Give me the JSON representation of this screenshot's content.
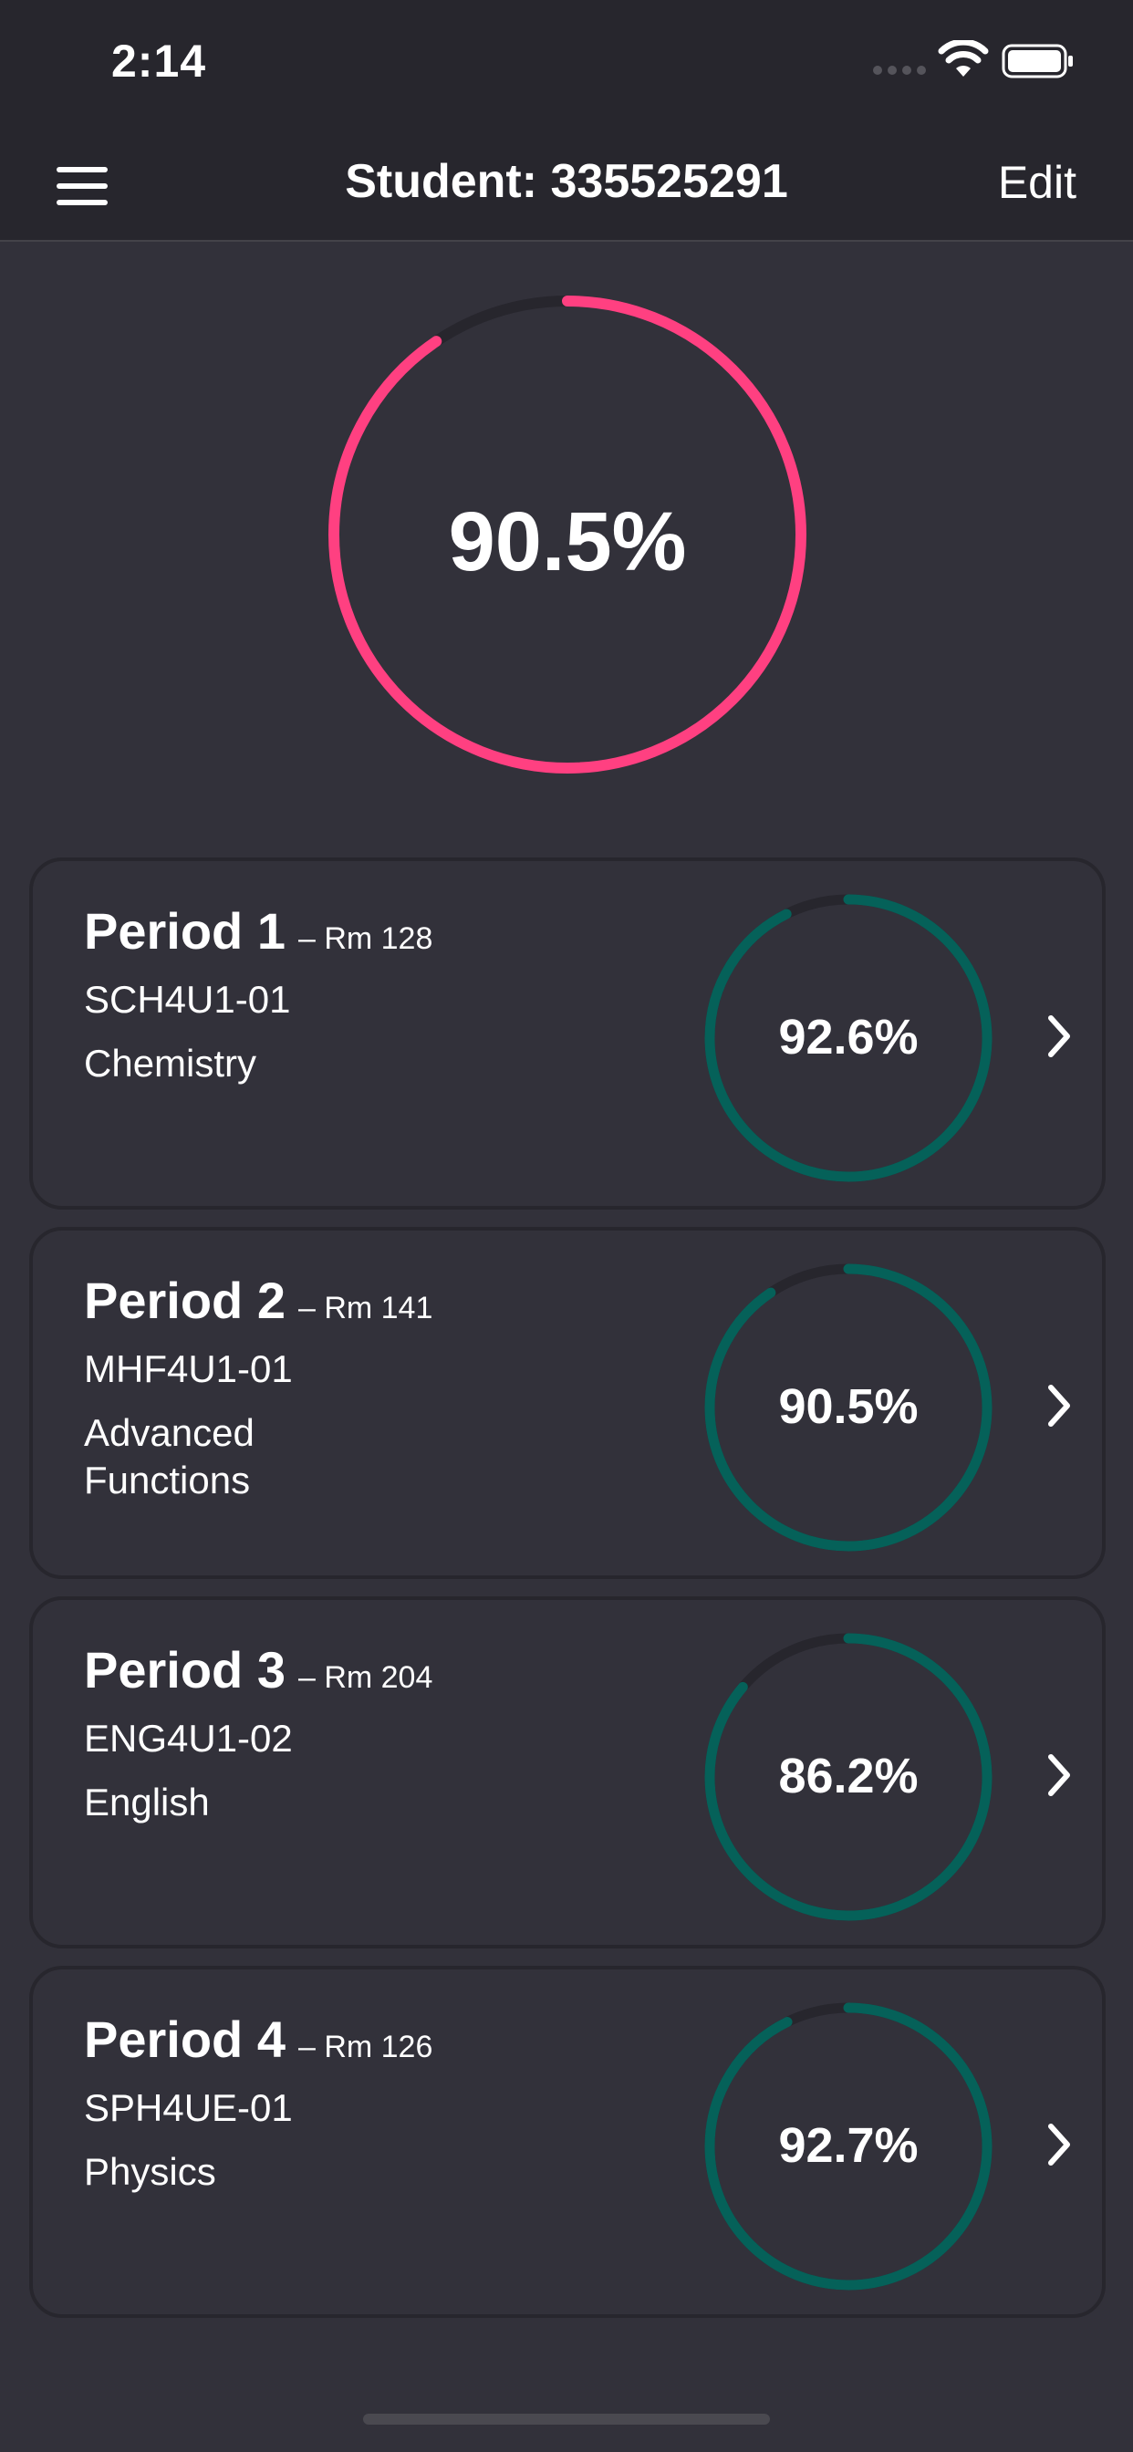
{
  "status_bar": {
    "time": "2:14"
  },
  "nav": {
    "title": "Student: 335525291",
    "edit_label": "Edit"
  },
  "overall": {
    "value_text": "90.5%",
    "fraction": 0.905,
    "color": "#ff4081"
  },
  "ring_colors": {
    "track": "#27262d",
    "progress": "#056159"
  },
  "periods": [
    {
      "name": "Period 1",
      "room": "– Rm 128",
      "code": "SCH4U1-01",
      "course": "Chemistry",
      "grade_text": "92.6%",
      "fraction": 0.926
    },
    {
      "name": "Period 2",
      "room": "– Rm 141",
      "code": "MHF4U1-01",
      "course": "Advanced Functions",
      "grade_text": "90.5%",
      "fraction": 0.905
    },
    {
      "name": "Period 3",
      "room": "– Rm 204",
      "code": "ENG4U1-02",
      "course": "English",
      "grade_text": "86.2%",
      "fraction": 0.862
    },
    {
      "name": "Period 4",
      "room": "– Rm 126",
      "code": "SPH4UE-01",
      "course": "Physics",
      "grade_text": "92.7%",
      "fraction": 0.927
    }
  ]
}
